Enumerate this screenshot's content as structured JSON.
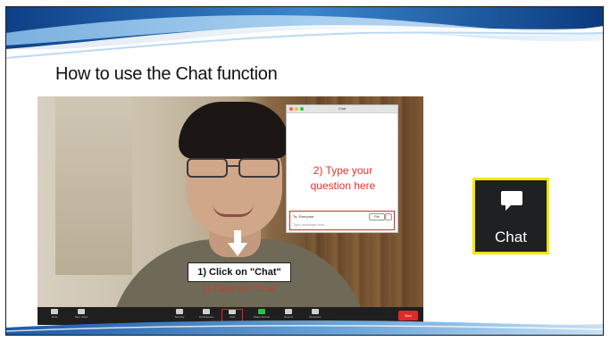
{
  "slide": {
    "title": "How to use the Chat function"
  },
  "video": {
    "step1_label": "1) Click on \"Chat\"",
    "step1_label_echo": "1) Click on \"Chat\""
  },
  "chat_window": {
    "title": "Chat",
    "prompt_line1": "2) Type your",
    "prompt_line2": "question here",
    "to_label": "To: Everyone",
    "file_label": "File",
    "more_label": "···",
    "input_placeholder": "Type message here..."
  },
  "toolbar": {
    "items": [
      {
        "label": "Mute"
      },
      {
        "label": "Stop Video"
      },
      {
        "label": "Security"
      },
      {
        "label": "Participants"
      },
      {
        "label": "Chat"
      },
      {
        "label": "Share Screen"
      },
      {
        "label": "Record"
      },
      {
        "label": "Reactions"
      }
    ],
    "end_label": "End"
  },
  "chat_badge": {
    "label": "Chat"
  },
  "colors": {
    "callout_red": "#e2322c",
    "badge_border": "#f2e600",
    "badge_bg": "#1f2022",
    "banner_blue": "#1e5fa8"
  },
  "icons": {
    "chat_badge_icon": "speech-bubble-icon",
    "arrow": "arrow-down-icon"
  }
}
